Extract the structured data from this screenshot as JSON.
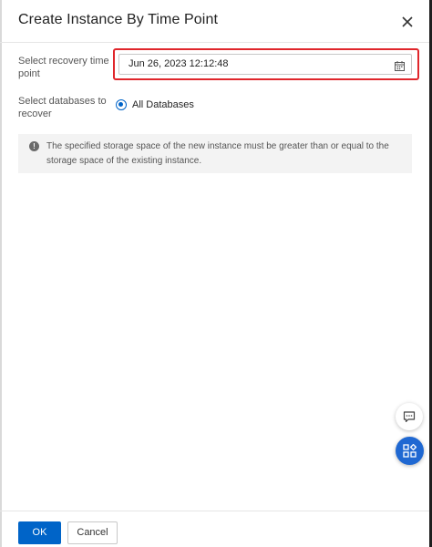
{
  "dialog": {
    "title": "Create Instance By Time Point",
    "close_icon": "close-icon"
  },
  "form": {
    "recovery_time_label": "Select recovery time point",
    "recovery_time_value": "Jun 26, 2023 12:12:48",
    "calendar_icon": "calendar-icon",
    "databases_label": "Select databases to recover",
    "databases_option": "All Databases",
    "databases_selected": true
  },
  "notice": {
    "icon": "exclamation-icon",
    "text": "The specified storage space of the new instance must be greater than or equal to the storage space of the existing instance."
  },
  "floating": {
    "chat_icon": "chat-icon",
    "apps_icon": "apps-icon"
  },
  "footer": {
    "ok_label": "OK",
    "cancel_label": "Cancel"
  },
  "colors": {
    "primary": "#0064c8",
    "highlight": "#e0262b",
    "fab_blue": "#1f68d2"
  }
}
